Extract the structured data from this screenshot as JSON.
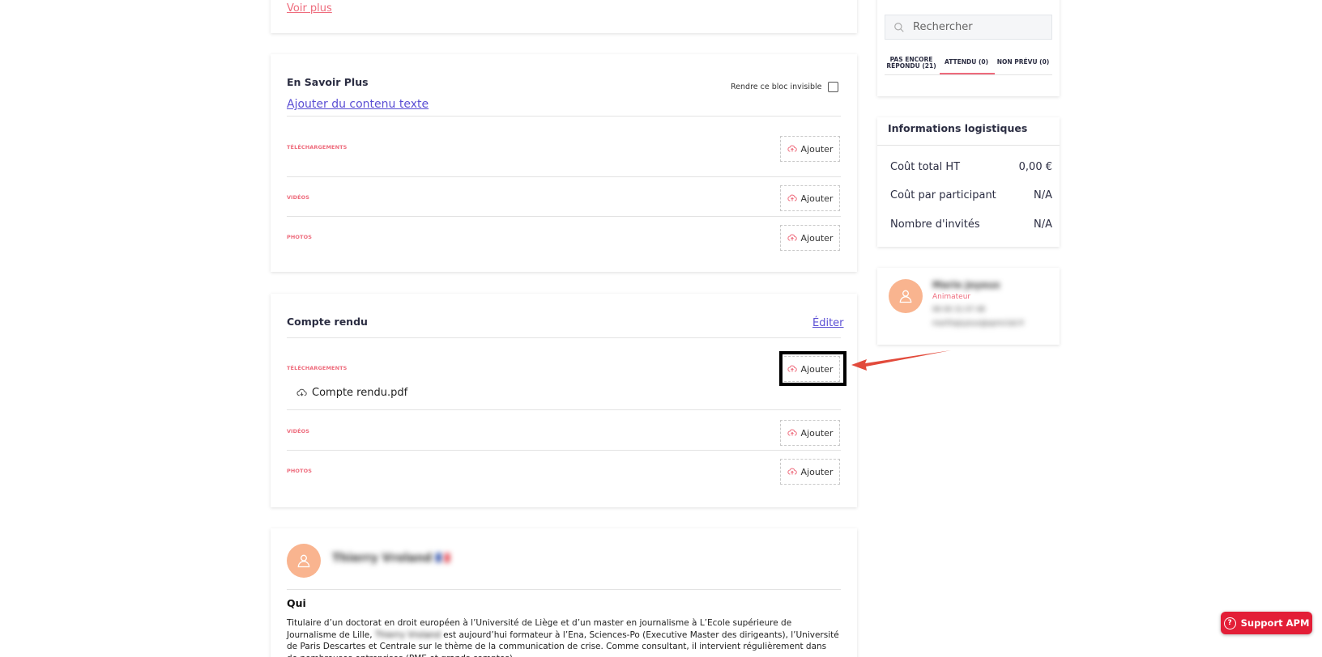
{
  "top_card": {
    "voir_plus": "Voir plus"
  },
  "en_savoir_plus": {
    "title": "En Savoir Plus",
    "invisible_label": "Rendre ce bloc invisible",
    "add_text_link": "Ajouter du contenu texte",
    "sections": [
      {
        "label": "TÉLÉCHARGEMENTS",
        "button": "Ajouter"
      },
      {
        "label": "VIDÉOS",
        "button": "Ajouter"
      },
      {
        "label": "PHOTOS",
        "button": "Ajouter"
      }
    ]
  },
  "compte_rendu": {
    "title": "Compte rendu",
    "edit_link": "Éditer",
    "sections": [
      {
        "label": "TÉLÉCHARGEMENTS",
        "button": "Ajouter"
      },
      {
        "label": "VIDÉOS",
        "button": "Ajouter"
      },
      {
        "label": "PHOTOS",
        "button": "Ajouter"
      }
    ],
    "file": "Compte rendu.pdf"
  },
  "speaker_card": {
    "name": "Thierry Vroland 🇫🇷",
    "qui_title": "Qui",
    "bio_before": "Titulaire d’un doctorat en droit européen à l’Université de Liège et d’un master en journalisme à L’Ecole supérieure de Journalisme de Lille, ",
    "bio_blurred": "Thierry Vroland",
    "bio_after": " est aujourd’hui formateur à l’Ena, Sciences-Po (Executive Master des dirigeants), l’Université de Paris Descartes et Centrale sur le thème de la communication de crise. Comme consultant, il intervient régulièrement dans de nombreuses entreprises (PME et grands comptes)."
  },
  "participants": {
    "search_placeholder": "Rechercher",
    "tabs": [
      {
        "line1": "PAS ENCORE",
        "line2": "RÉPONDU (21)"
      },
      {
        "line1": "ATTENDU (0)",
        "line2": ""
      },
      {
        "line1": "NON PRÉVU (0)",
        "line2": ""
      }
    ],
    "active_tab": 1
  },
  "logistics": {
    "title": "Informations logistiques",
    "rows": [
      {
        "label": "Coût total HT",
        "value": "0,00 €"
      },
      {
        "label": "Coût par participant",
        "value": "N/A"
      },
      {
        "label": "Nombre d'invités",
        "value": "N/A"
      }
    ]
  },
  "animator": {
    "name": "Marie Joyeux",
    "role": "Animateur",
    "phone": "06 00 31 07 48",
    "email": "marthajoyeux@apmclub.fr"
  },
  "support": {
    "label": "Support APM"
  },
  "colors": {
    "accent": "#ee6b7c",
    "link": "#5b4fd4",
    "avatar": "#f9b48f",
    "support": "#e31e37"
  }
}
